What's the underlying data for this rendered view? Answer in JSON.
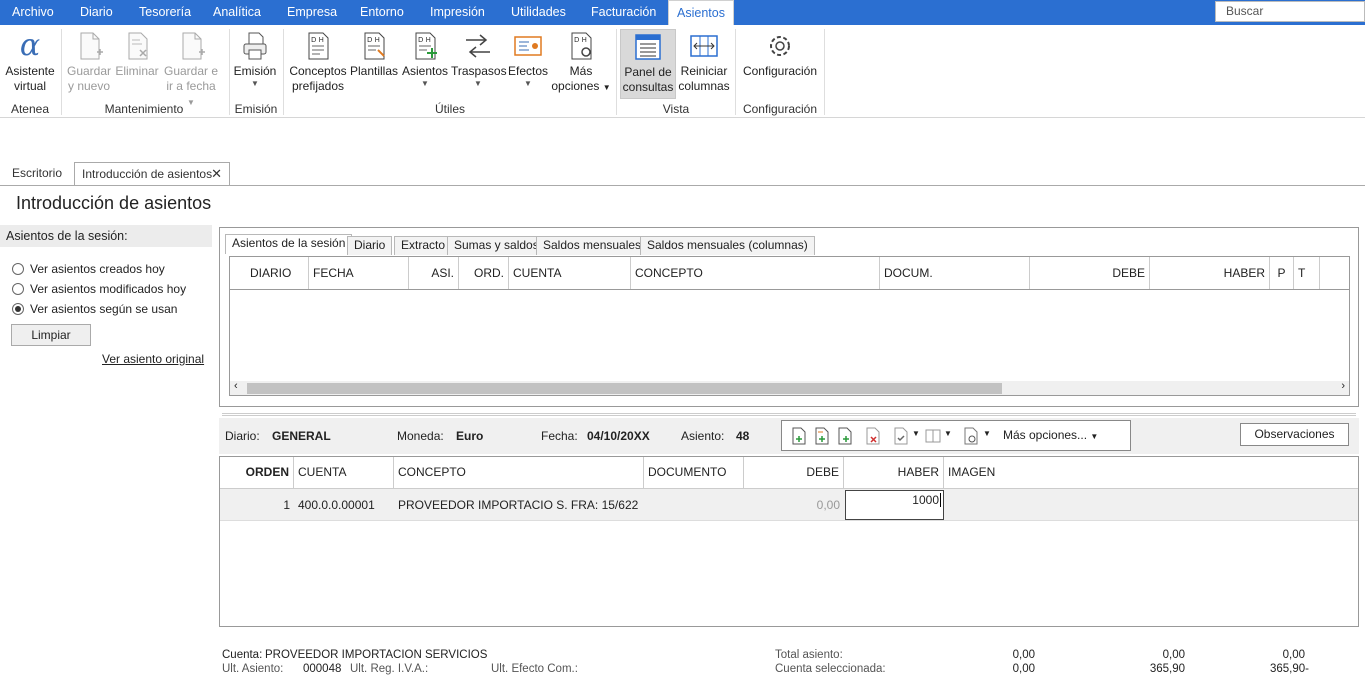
{
  "menu": {
    "items": [
      "Archivo",
      "Diario",
      "Tesorería",
      "Analítica",
      "Empresa",
      "Entorno",
      "Impresión",
      "Utilidades",
      "Facturación",
      "Asientos"
    ],
    "active": "Asientos",
    "search_placeholder": "Buscar"
  },
  "ribbon": {
    "buttons": {
      "asistente": [
        "Asistente",
        "virtual"
      ],
      "guardar_nuevo": [
        "Guardar",
        "y nuevo"
      ],
      "eliminar": "Eliminar",
      "guardar_fecha": [
        "Guardar e",
        "ir a fecha"
      ],
      "emision": "Emisión",
      "conceptos": [
        "Conceptos",
        "prefijados"
      ],
      "plantillas": "Plantillas",
      "asientos": "Asientos",
      "traspasos": "Traspasos",
      "efectos": "Efectos",
      "mas_opciones": [
        "Más",
        "opciones"
      ],
      "panel": [
        "Panel de",
        "consultas"
      ],
      "reiniciar": [
        "Reiniciar",
        "columnas"
      ],
      "configuracion": "Configuración"
    },
    "groups": {
      "atenea": "Atenea",
      "mantenimiento": "Mantenimiento",
      "emision": "Emisión",
      "utiles": "Útiles",
      "vista": "Vista",
      "configuracion": "Configuración"
    }
  },
  "doc_tabs": {
    "escritorio": "Escritorio",
    "introduccion": "Introducción de asientos"
  },
  "page_title": "Introducción de asientos",
  "left_panel": {
    "header": "Asientos de la sesión:",
    "options": [
      "Ver asientos creados hoy",
      "Ver asientos modificados hoy",
      "Ver asientos según se usan"
    ],
    "selected_index": 2,
    "limpiar": "Limpiar",
    "ver_original": "Ver asiento original"
  },
  "upper_tabs": [
    "Asientos de la sesión",
    "Diario",
    "Extracto",
    "Sumas y saldos",
    "Saldos mensuales",
    "Saldos mensuales (columnas)"
  ],
  "upper_grid": {
    "columns": [
      "DIARIO",
      "FECHA",
      "ASI.",
      "ORD.",
      "CUENTA",
      "CONCEPTO",
      "DOCUM.",
      "DEBE",
      "HABER",
      "P",
      "T"
    ]
  },
  "info": {
    "diario_label": "Diario:",
    "diario_value": "GENERAL",
    "moneda_label": "Moneda:",
    "moneda_value": "Euro",
    "fecha_label": "Fecha:",
    "fecha_value": "04/10/20XX",
    "asiento_label": "Asiento:",
    "asiento_value": "48",
    "mas_opciones": "Más opciones...",
    "observaciones": "Observaciones"
  },
  "lower_grid": {
    "columns": [
      "ORDEN",
      "CUENTA",
      "CONCEPTO",
      "DOCUMENTO",
      "DEBE",
      "HABER",
      "IMAGEN"
    ],
    "row": {
      "orden": "1",
      "cuenta": "400.0.0.00001",
      "concepto": "PROVEEDOR IMPORTACIO S. FRA:  15/622",
      "documento": "",
      "debe": "0,00",
      "haber": "1000"
    }
  },
  "footer": {
    "cuenta_label": "Cuenta:",
    "cuenta_value": "PROVEEDOR IMPORTACION SERVICIOS",
    "ult_asiento_label": "Ult. Asiento:",
    "ult_asiento_value": "000048",
    "ult_iva_label": "Ult. Reg. I.V.A.:",
    "ult_efecto_label": "Ult. Efecto Com.:",
    "total_label": "Total asiento:",
    "seleccionada_label": "Cuenta seleccionada:",
    "total_values": [
      "0,00",
      "0,00",
      "0,00"
    ],
    "seleccionada_values": [
      "0,00",
      "365,90",
      "365,90-"
    ]
  }
}
